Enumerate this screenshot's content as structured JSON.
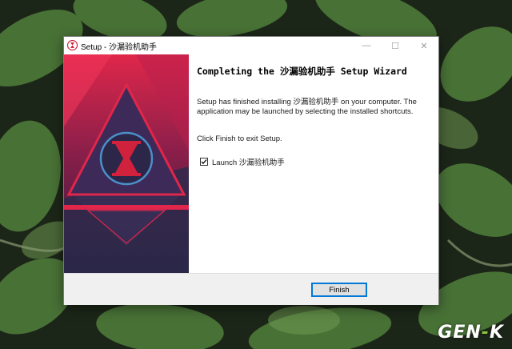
{
  "window": {
    "title": "Setup - 沙漏验机助手",
    "app_icon": "hourglass-icon",
    "minimize_glyph": "—",
    "maximize_glyph": "☐",
    "close_glyph": "✕"
  },
  "content": {
    "heading": "Completing the 沙漏验机助手 Setup Wizard",
    "description": "Setup has finished installing 沙漏验机助手 on your computer. The application may be launched by selecting the installed shortcuts.",
    "exit_instruction": "Click Finish to exit Setup.",
    "launch_checkbox": {
      "label": "Launch 沙漏验机助手",
      "checked": true
    }
  },
  "footer": {
    "finish_label": "Finish"
  },
  "watermark": {
    "left": "GEN",
    "dash": "-",
    "right": "K"
  },
  "colors": {
    "accent": "#0078d7",
    "banner_red": "#e0264a",
    "banner_dark": "#2a1d3a",
    "hourglass_ring": "#4b8fc9"
  }
}
